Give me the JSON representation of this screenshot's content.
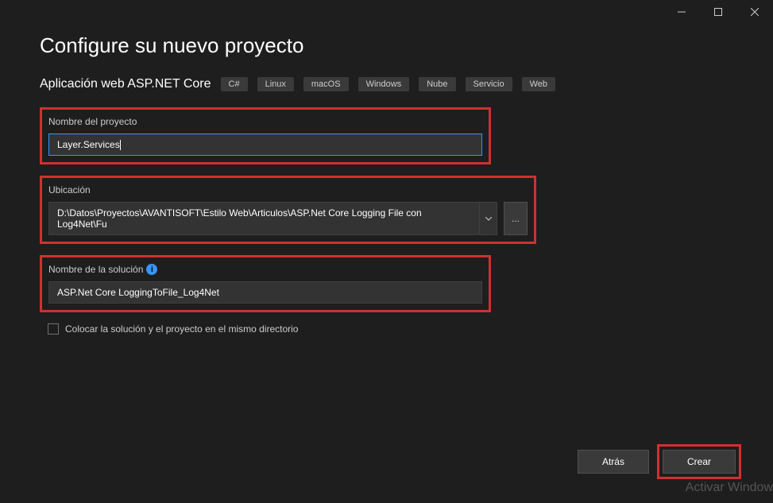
{
  "titlebar": {
    "minimize": "─",
    "maximize": "☐",
    "close": "✕"
  },
  "page": {
    "title": "Configure su nuevo proyecto",
    "subtitle": "Aplicación web ASP.NET Core"
  },
  "tags": [
    "C#",
    "Linux",
    "macOS",
    "Windows",
    "Nube",
    "Servicio",
    "Web"
  ],
  "form": {
    "project_name_label": "Nombre del proyecto",
    "project_name_value": "Layer.Services",
    "location_label": "Ubicación",
    "location_value": "D:\\Datos\\Proyectos\\AVANTISOFT\\Estilo Web\\Articulos\\ASP.Net Core Logging File con Log4Net\\Fu",
    "browse_label": "...",
    "solution_name_label": "Nombre de la solución",
    "solution_name_value": "ASP.Net Core LoggingToFile_Log4Net",
    "checkbox_label": "Colocar la solución y el proyecto en el mismo directorio"
  },
  "buttons": {
    "back": "Atrás",
    "create": "Crear"
  },
  "watermark": "Activar Window"
}
